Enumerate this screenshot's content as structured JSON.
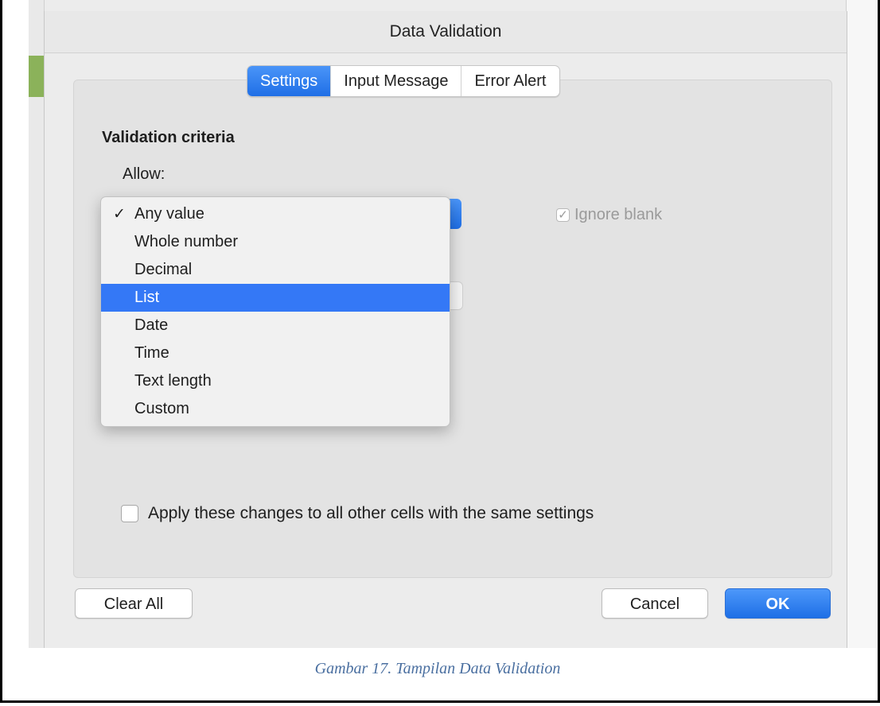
{
  "dialog": {
    "title": "Data Validation",
    "tabs": [
      {
        "label": "Settings",
        "active": true
      },
      {
        "label": "Input Message",
        "active": false
      },
      {
        "label": "Error Alert",
        "active": false
      }
    ],
    "section_title": "Validation criteria",
    "allow_label": "Allow:",
    "ignore_blank": {
      "label": "Ignore blank",
      "checked": true,
      "enabled": false
    },
    "allow_options": [
      {
        "label": "Any value",
        "checked": true,
        "highlighted": false
      },
      {
        "label": "Whole number",
        "checked": false,
        "highlighted": false
      },
      {
        "label": "Decimal",
        "checked": false,
        "highlighted": false
      },
      {
        "label": "List",
        "checked": false,
        "highlighted": true
      },
      {
        "label": "Date",
        "checked": false,
        "highlighted": false
      },
      {
        "label": "Time",
        "checked": false,
        "highlighted": false
      },
      {
        "label": "Text length",
        "checked": false,
        "highlighted": false
      },
      {
        "label": "Custom",
        "checked": false,
        "highlighted": false
      }
    ],
    "apply_all": {
      "label": "Apply these changes to all other cells with the same settings",
      "checked": false
    },
    "buttons": {
      "clear_all": "Clear All",
      "cancel": "Cancel",
      "ok": "OK"
    },
    "check_glyph": "✓"
  },
  "caption": "Gambar 17. Tampilan Data Validation",
  "colors": {
    "accent": "#3478f6",
    "caption": "#4a6fa0"
  }
}
